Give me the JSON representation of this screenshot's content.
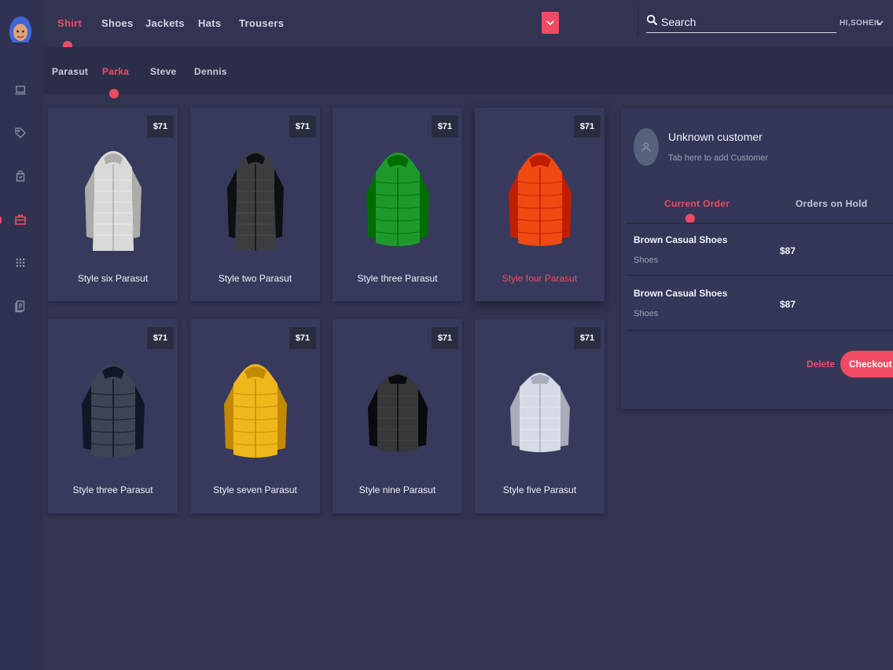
{
  "sidebar": {
    "icons": [
      "laptop-icon",
      "tag-icon",
      "shopping-bag-icon",
      "briefcase-icon",
      "grid-icon",
      "document-icon"
    ],
    "active_index": 3,
    "accent": "#f04b62"
  },
  "topbar": {
    "categories": [
      {
        "label": "Shirt",
        "active": true
      },
      {
        "label": "Shoes",
        "active": false
      },
      {
        "label": "Jackets",
        "active": false
      },
      {
        "label": "Hats",
        "active": false
      },
      {
        "label": "Trousers",
        "active": false
      }
    ],
    "search_label": "Search",
    "user_greeting": "HI,SOHEIL"
  },
  "subbar": {
    "tabs": [
      {
        "label": "Parasut",
        "active": false
      },
      {
        "label": "Parka",
        "active": true
      },
      {
        "label": "Steve",
        "active": false
      },
      {
        "label": "Dennis",
        "active": false
      }
    ]
  },
  "products": [
    {
      "name": "Style six Parasut",
      "price": "$71",
      "color": "#d9dad6",
      "featured": false
    },
    {
      "name": "Style two Parasut",
      "price": "$71",
      "color": "#3c3d40",
      "featured": false
    },
    {
      "name": "Style three Parasut",
      "price": "$71",
      "color": "#1e9a2d",
      "featured": false
    },
    {
      "name": "Style four Parasut",
      "price": "$71",
      "color": "#ee4a12",
      "featured": true
    },
    {
      "name": "Style three Parasut",
      "price": "$71",
      "color": "#3e4453",
      "featured": false
    },
    {
      "name": "Style seven Parasut",
      "price": "$71",
      "color": "#f0b71c",
      "featured": false
    },
    {
      "name": "Style nine Parasut",
      "price": "$71",
      "color": "#36383b",
      "featured": false
    },
    {
      "name": "Style five Parasut",
      "price": "$71",
      "color": "#d6d9e6",
      "featured": false
    }
  ],
  "order_panel": {
    "customer_name": "Unknown customer",
    "customer_hint": "Tab here to add Customer",
    "tabs": {
      "current": "Current Order",
      "hold": "Orders on Hold"
    },
    "items": [
      {
        "name": "Brown Casual Shoes",
        "category": "Shoes",
        "price": "$87"
      },
      {
        "name": "Brown Casual Shoes",
        "category": "Shoes",
        "price": "$87"
      }
    ],
    "delete_label": "Delete",
    "checkout_label": "Checkout"
  }
}
